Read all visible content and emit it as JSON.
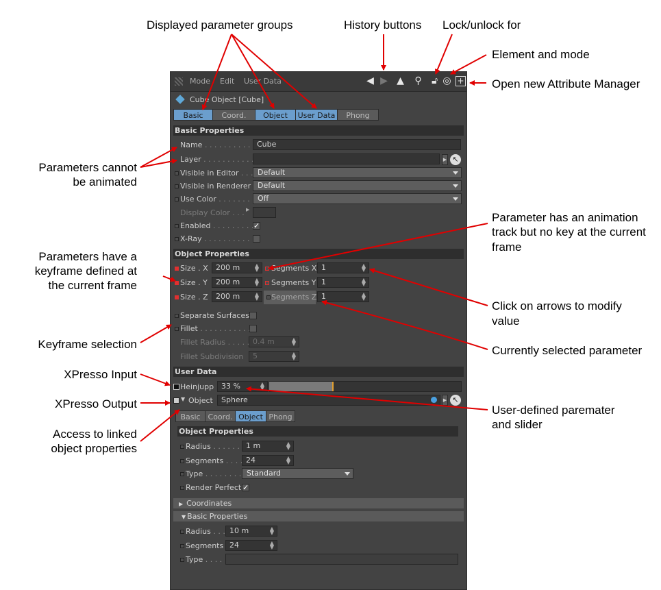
{
  "annotations": {
    "param_groups": "Displayed parameter groups",
    "history": "History buttons",
    "lock_1": "Lock/unlock for",
    "lock_2": "Element and mode",
    "open_new": "Open new Attribute Manager",
    "cannot_animate_1": "Parameters cannot",
    "cannot_animate_2": "be animated",
    "track_1": "Parameter has an animation",
    "track_2": "track but no key at the current",
    "track_3": "frame",
    "keyframe_1": "Parameters have a",
    "keyframe_2": "keyframe defined at",
    "keyframe_3": "the current frame",
    "arrows_1": "Click on arrows to modify",
    "arrows_2": "value",
    "key_selection": "Keyframe selection",
    "selected_param": "Currently selected parameter",
    "xpresso_input": "XPresso Input",
    "xpresso_output": "XPresso Output",
    "user_param_1": "User-defined paremater",
    "user_param_2": "and slider",
    "linked_1": "Access to linked",
    "linked_2": "object properties"
  },
  "menu": {
    "mode": "Mode",
    "edit": "Edit",
    "user_data": "User Data"
  },
  "toolbar_icons": [
    "back-arrow-icon",
    "forward-arrow-icon",
    "navigate-up-icon",
    "search-icon",
    "lock-icon",
    "target-icon",
    "new-manager-icon"
  ],
  "object_title": "Cube Object [Cube]",
  "tabs": [
    {
      "label": "Basic",
      "active": true
    },
    {
      "label": "Coord.",
      "active": false
    },
    {
      "label": "Object",
      "active": true
    },
    {
      "label": "User Data",
      "active": true
    },
    {
      "label": "Phong",
      "active": false
    }
  ],
  "basic": {
    "header": "Basic Properties",
    "name_label": "Name",
    "name_value": "Cube",
    "layer_label": "Layer",
    "vis_editor_label": "Visible in Editor",
    "vis_editor_value": "Default",
    "vis_render_label": "Visible in Renderer",
    "vis_render_value": "Default",
    "use_color_label": "Use Color",
    "use_color_value": "Off",
    "display_color_label": "Display Color",
    "enabled_label": "Enabled",
    "enabled_check": "✓",
    "xray_label": "X-Ray"
  },
  "object": {
    "header": "Object Properties",
    "size_x_label": "Size . X",
    "size_x": "200 m",
    "size_y_label": "Size . Y",
    "size_y": "200 m",
    "size_z_label": "Size . Z",
    "size_z": "200 m",
    "seg_x_label": "Segments X",
    "seg_x": "1",
    "seg_y_label": "Segments Y",
    "seg_y": "1",
    "seg_z_label": "Segments Z",
    "seg_z": "1",
    "sep_label": "Separate Surfaces",
    "fillet_label": "Fillet",
    "fillet_radius_label": "Fillet Radius",
    "fillet_radius": "0.4 m",
    "fillet_sub_label": "Fillet Subdivision",
    "fillet_sub": "5"
  },
  "user_data": {
    "header": "User Data",
    "heinjupp_label": "Heinjupp",
    "heinjupp_value": "33 %",
    "heinjupp_fraction": 0.33,
    "object_label": "Object",
    "object_value": "Sphere"
  },
  "linked_tabs": [
    {
      "label": "Basic",
      "active": false
    },
    {
      "label": "Coord.",
      "active": false
    },
    {
      "label": "Object",
      "active": true
    },
    {
      "label": "Phong",
      "active": false
    }
  ],
  "linked": {
    "header": "Object Properties",
    "radius_label": "Radius",
    "radius": "1 m",
    "segments_label": "Segments",
    "segments": "24",
    "type_label": "Type",
    "type_value": "Standard",
    "render_perfect_label": "Render Perfect",
    "render_perfect_check": "✓",
    "coordinates_fold": "Coordinates",
    "basic_fold": "Basic Properties",
    "radius2_label": "Radius",
    "radius2": "10 m",
    "segments2_label": "Segments",
    "segments2": "24",
    "type2_label": "Type"
  },
  "colors": {
    "panel_bg": "#434343",
    "tab_active": "#6b9ecd",
    "key_red": "#e03030",
    "arrow_red": "#e00000"
  }
}
